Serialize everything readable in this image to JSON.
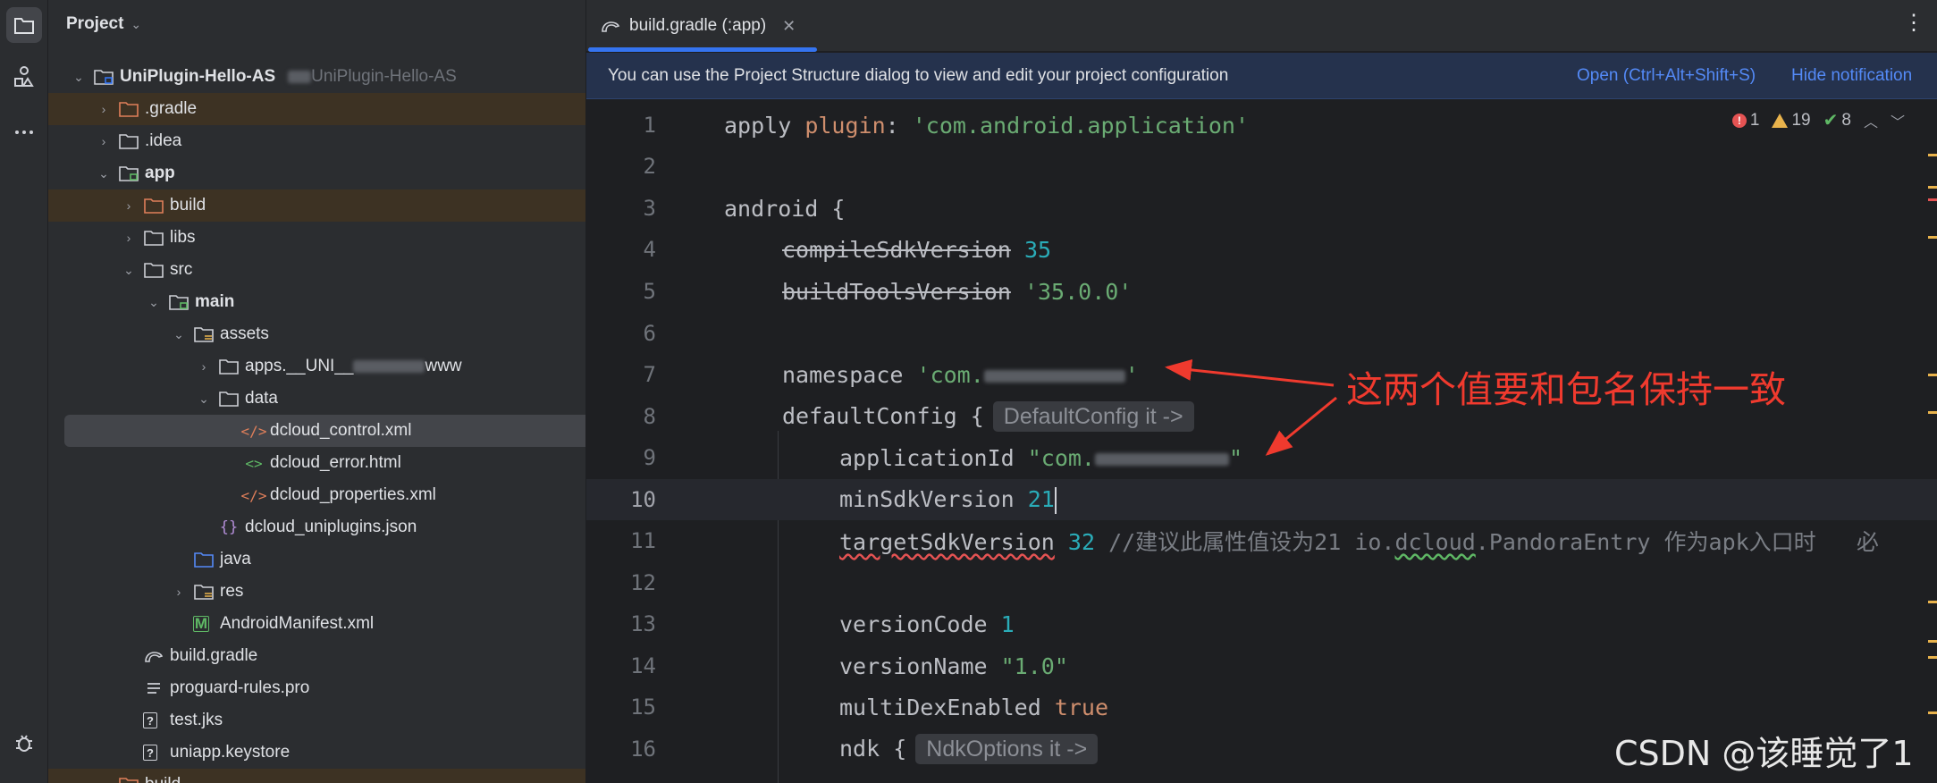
{
  "activity_bar": {
    "items": [
      {
        "icon": "folder-icon",
        "active": true
      },
      {
        "icon": "structure-icon",
        "active": false
      },
      {
        "icon": "more-icon",
        "active": false
      },
      {
        "icon": "bug-icon",
        "active": false
      }
    ]
  },
  "project": {
    "title": "Project",
    "tree": [
      {
        "label": "UniPlugin-Hello-AS",
        "bold": true,
        "sub": "UniPlugin-Hello-AS",
        "icon": "module-folder-icon"
      },
      {
        "label": ".gradle",
        "icon": "folder-orange-icon",
        "excluded": true
      },
      {
        "label": ".idea",
        "icon": "folder-icon"
      },
      {
        "label": "app",
        "bold": true,
        "icon": "module-folder-icon"
      },
      {
        "label": "build",
        "icon": "folder-orange-icon",
        "excluded": true
      },
      {
        "label": "libs",
        "icon": "folder-icon"
      },
      {
        "label": "src",
        "icon": "folder-icon"
      },
      {
        "label": "main",
        "bold": true,
        "icon": "module-folder-icon"
      },
      {
        "label": "assets",
        "icon": "resource-folder-icon"
      },
      {
        "label": "apps.__UNI__",
        "label_tail": "www",
        "icon": "folder-icon"
      },
      {
        "label": "data",
        "icon": "folder-icon"
      },
      {
        "label": "dcloud_control.xml",
        "icon": "xml-file-icon",
        "selected": true
      },
      {
        "label": "dcloud_error.html",
        "icon": "html-file-icon"
      },
      {
        "label": "dcloud_properties.xml",
        "icon": "xml-file-icon"
      },
      {
        "label": "dcloud_uniplugins.json",
        "icon": "json-file-icon"
      },
      {
        "label": "java",
        "icon": "source-folder-icon"
      },
      {
        "label": "res",
        "icon": "resource-folder-icon"
      },
      {
        "label": "AndroidManifest.xml",
        "icon": "manifest-file-icon"
      },
      {
        "label": "build.gradle",
        "icon": "gradle-file-icon"
      },
      {
        "label": "proguard-rules.pro",
        "icon": "text-file-icon"
      },
      {
        "label": "test.jks",
        "icon": "unknown-file-icon"
      },
      {
        "label": "uniapp.keystore",
        "icon": "unknown-file-icon"
      },
      {
        "label": "build",
        "icon": "folder-orange-icon",
        "excluded": true
      }
    ]
  },
  "editor": {
    "tab_label": "build.gradle (:app)",
    "more_label": "⋮",
    "notification": {
      "text": "You can use the Project Structure dialog to view and edit your project configuration",
      "open_label": "Open (Ctrl+Alt+Shift+S)",
      "hide_label": "Hide notification"
    },
    "inspections": {
      "errors": "1",
      "warnings": "19",
      "weak": "8"
    },
    "lines": {
      "1": {
        "a": "apply ",
        "b": "plugin",
        "c": ": ",
        "d": "'com.android.application'"
      },
      "3": {
        "a": "android {"
      },
      "4": {
        "a": "compileSdkVersion",
        "b": "35"
      },
      "5": {
        "a": "buildToolsVersion",
        "b": "'35.0.0'"
      },
      "7": {
        "a": "namespace ",
        "b": "'com.",
        "c": "'"
      },
      "8": {
        "a": "defaultConfig {",
        "hint": "DefaultConfig it ->"
      },
      "9": {
        "a": "applicationId ",
        "b": "\"com.",
        "c": "\""
      },
      "10": {
        "a": "minSdkVersion ",
        "b": "21"
      },
      "11": {
        "a": "targetSdkVersion",
        "b": "32",
        "c": "//建议此属性值设为21 io.",
        "d": "dcloud",
        "e": ".PandoraEntry 作为apk入口时   必"
      },
      "13": {
        "a": "versionCode ",
        "b": "1"
      },
      "14": {
        "a": "versionName ",
        "b": "\"1.0\""
      },
      "15": {
        "a": "multiDexEnabled ",
        "b": "true"
      },
      "16": {
        "a": "ndk {",
        "hint": "NdkOptions it ->"
      }
    }
  },
  "annotation": "这两个值要和包名保持一致",
  "watermark": "CSDN @该睡觉了1"
}
